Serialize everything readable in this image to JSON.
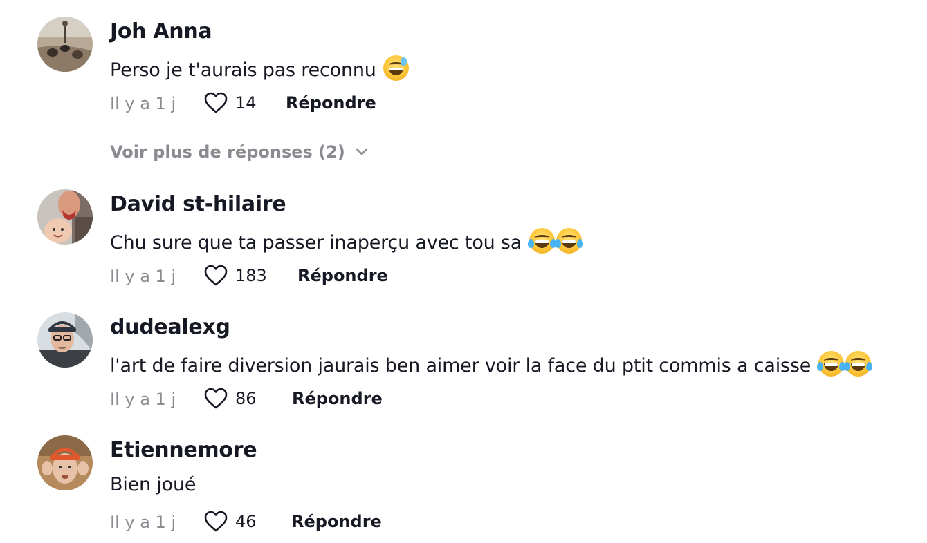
{
  "comments": [
    {
      "username": "Joh Anna",
      "text": "Perso je t'aurais pas reconnu",
      "emojis": [
        "sweat-smile"
      ],
      "time": "Il y a 1 j",
      "likes": "14",
      "reply_label": "Répondre",
      "avatar_icon": "avatar-dogs-photo"
    },
    {
      "username": "David st-hilaire",
      "text": "Chu sure que ta passer inaperçu avec tou sa",
      "emojis": [
        "joy",
        "joy"
      ],
      "time": "Il y a 1 j",
      "likes": "183",
      "reply_label": "Répondre",
      "avatar_icon": "avatar-father-baby-photo"
    },
    {
      "username": "dudealexg",
      "text": "l'art de faire diversion jaurais ben aimer voir la face du ptit commis a caisse",
      "emojis": [
        "joy",
        "joy"
      ],
      "time": "Il y a 1 j",
      "likes": "86",
      "reply_label": "Répondre",
      "avatar_icon": "avatar-man-cap-photo"
    },
    {
      "username": "Etiennemore",
      "text": "Bien joué",
      "emojis": [],
      "time": "Il y a 1 j",
      "likes": "46",
      "reply_label": "Répondre",
      "avatar_icon": "avatar-man-orange-hat-photo"
    }
  ],
  "view_more_replies": "Voir plus de réponses (2)",
  "colors": {
    "text_primary": "#161823",
    "text_secondary": "#8a8b91",
    "background": "#ffffff"
  }
}
